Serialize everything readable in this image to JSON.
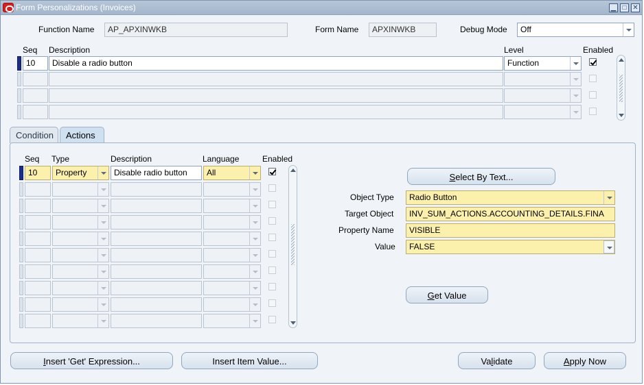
{
  "window": {
    "title": "Form Personalizations (Invoices)"
  },
  "header": {
    "function_name_label": "Function Name",
    "function_name_value": "AP_APXINWKB",
    "form_name_label": "Form Name",
    "form_name_value": "APXINWKB",
    "debug_mode_label": "Debug Mode",
    "debug_mode_value": "Off"
  },
  "rules": {
    "columns": {
      "seq": "Seq",
      "description": "Description",
      "level": "Level",
      "enabled": "Enabled"
    },
    "rows": [
      {
        "seq": "10",
        "description": "Disable a radio button",
        "level": "Function",
        "enabled": true
      },
      {
        "seq": "",
        "description": "",
        "level": "",
        "enabled": false
      },
      {
        "seq": "",
        "description": "",
        "level": "",
        "enabled": false
      },
      {
        "seq": "",
        "description": "",
        "level": "",
        "enabled": false
      }
    ]
  },
  "tabs": [
    {
      "label": "Condition",
      "active": false
    },
    {
      "label": "Actions",
      "active": true
    }
  ],
  "actions": {
    "columns": {
      "seq": "Seq",
      "type": "Type",
      "description": "Description",
      "language": "Language",
      "enabled": "Enabled"
    },
    "rows": [
      {
        "seq": "10",
        "type": "Property",
        "description": "Disable radio button",
        "language": "All",
        "enabled": true
      },
      {
        "seq": "",
        "type": "",
        "description": "",
        "language": "",
        "enabled": false
      },
      {
        "seq": "",
        "type": "",
        "description": "",
        "language": "",
        "enabled": false
      },
      {
        "seq": "",
        "type": "",
        "description": "",
        "language": "",
        "enabled": false
      },
      {
        "seq": "",
        "type": "",
        "description": "",
        "language": "",
        "enabled": false
      },
      {
        "seq": "",
        "type": "",
        "description": "",
        "language": "",
        "enabled": false
      },
      {
        "seq": "",
        "type": "",
        "description": "",
        "language": "",
        "enabled": false
      },
      {
        "seq": "",
        "type": "",
        "description": "",
        "language": "",
        "enabled": false
      },
      {
        "seq": "",
        "type": "",
        "description": "",
        "language": "",
        "enabled": false
      },
      {
        "seq": "",
        "type": "",
        "description": "",
        "language": "",
        "enabled": false
      }
    ]
  },
  "property": {
    "select_by_text_prefix": "S",
    "select_by_text_rest": "elect By Text...",
    "object_type_label": "Object Type",
    "object_type_value": "Radio Button",
    "target_object_label": "Target Object",
    "target_object_value": "INV_SUM_ACTIONS.ACCOUNTING_DETAILS.FINA",
    "property_name_label": "Property Name",
    "property_name_value": "VISIBLE",
    "value_label": "Value",
    "value_value": "FALSE",
    "get_value_prefix": "G",
    "get_value_rest": "et Value"
  },
  "footer": {
    "insert_get_prefix": "I",
    "insert_get_rest": "nsert 'Get' Expression...",
    "insert_item_value": "Insert Item Value...",
    "validate_prefix": "Va",
    "validate_mid": "l",
    "validate_rest": "idate",
    "apply_now_prefix": "A",
    "apply_now_rest": "pply Now"
  },
  "colors": {
    "title_bar": "#a4b6cc",
    "required_field": "#fcf0ad",
    "active_record_marker": "#1b2f8a"
  }
}
